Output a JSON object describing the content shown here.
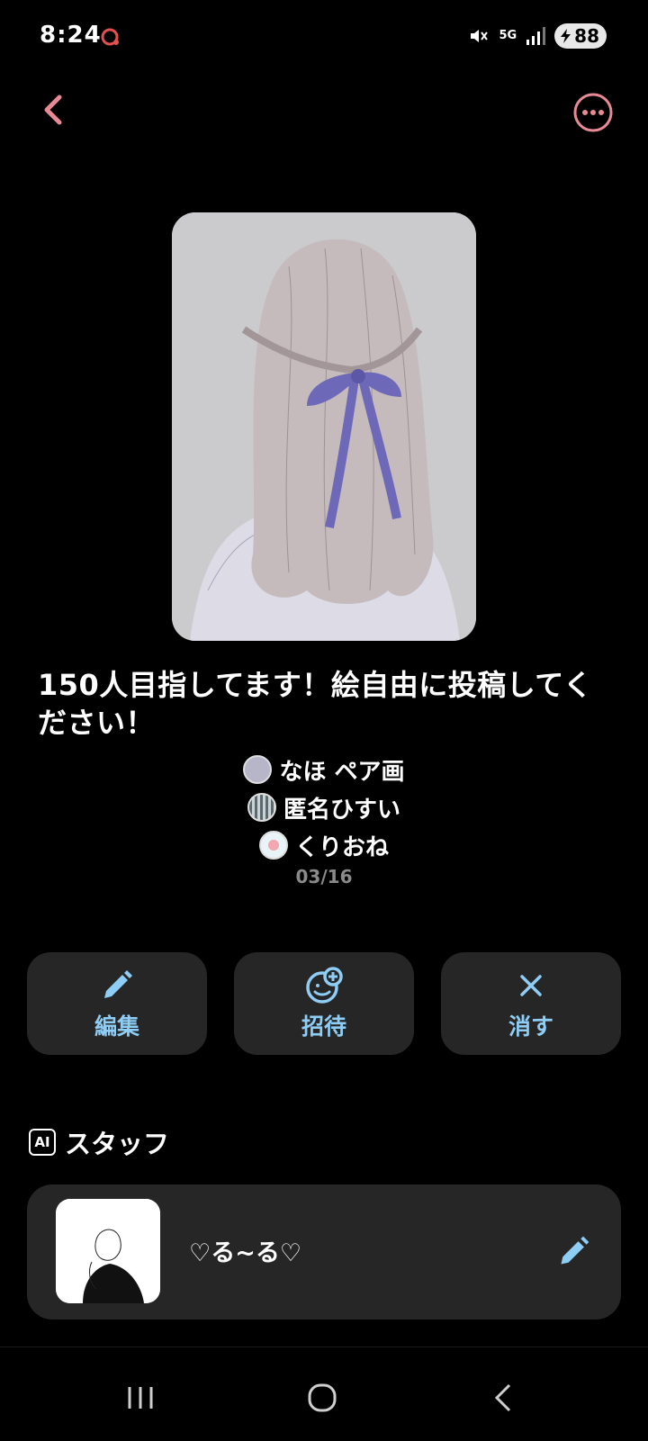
{
  "status": {
    "time": "8:24",
    "network": "5G",
    "battery": "88"
  },
  "header": {
    "back_icon": "chevron-left-icon",
    "more_icon": "more-options-icon",
    "accent_color": "#e88a96"
  },
  "chat": {
    "title": "150人目指してます！絵自由に投稿してください！",
    "members": [
      {
        "name": "なほ ペア画"
      },
      {
        "name": "匿名ひすい"
      },
      {
        "name": "くりおね"
      }
    ],
    "date": "03/16"
  },
  "actions": [
    {
      "label": "編集",
      "icon": "pencil-icon"
    },
    {
      "label": "招待",
      "icon": "add-person-icon"
    },
    {
      "label": "消す",
      "icon": "close-icon"
    }
  ],
  "staff_section": {
    "badge": "AI",
    "title": "スタッフ",
    "staff": [
      {
        "name": "♡る~る♡",
        "edit_icon": "pencil-icon"
      }
    ]
  },
  "colors": {
    "action_label": "#8ecdf5",
    "card_bg": "#262626"
  }
}
